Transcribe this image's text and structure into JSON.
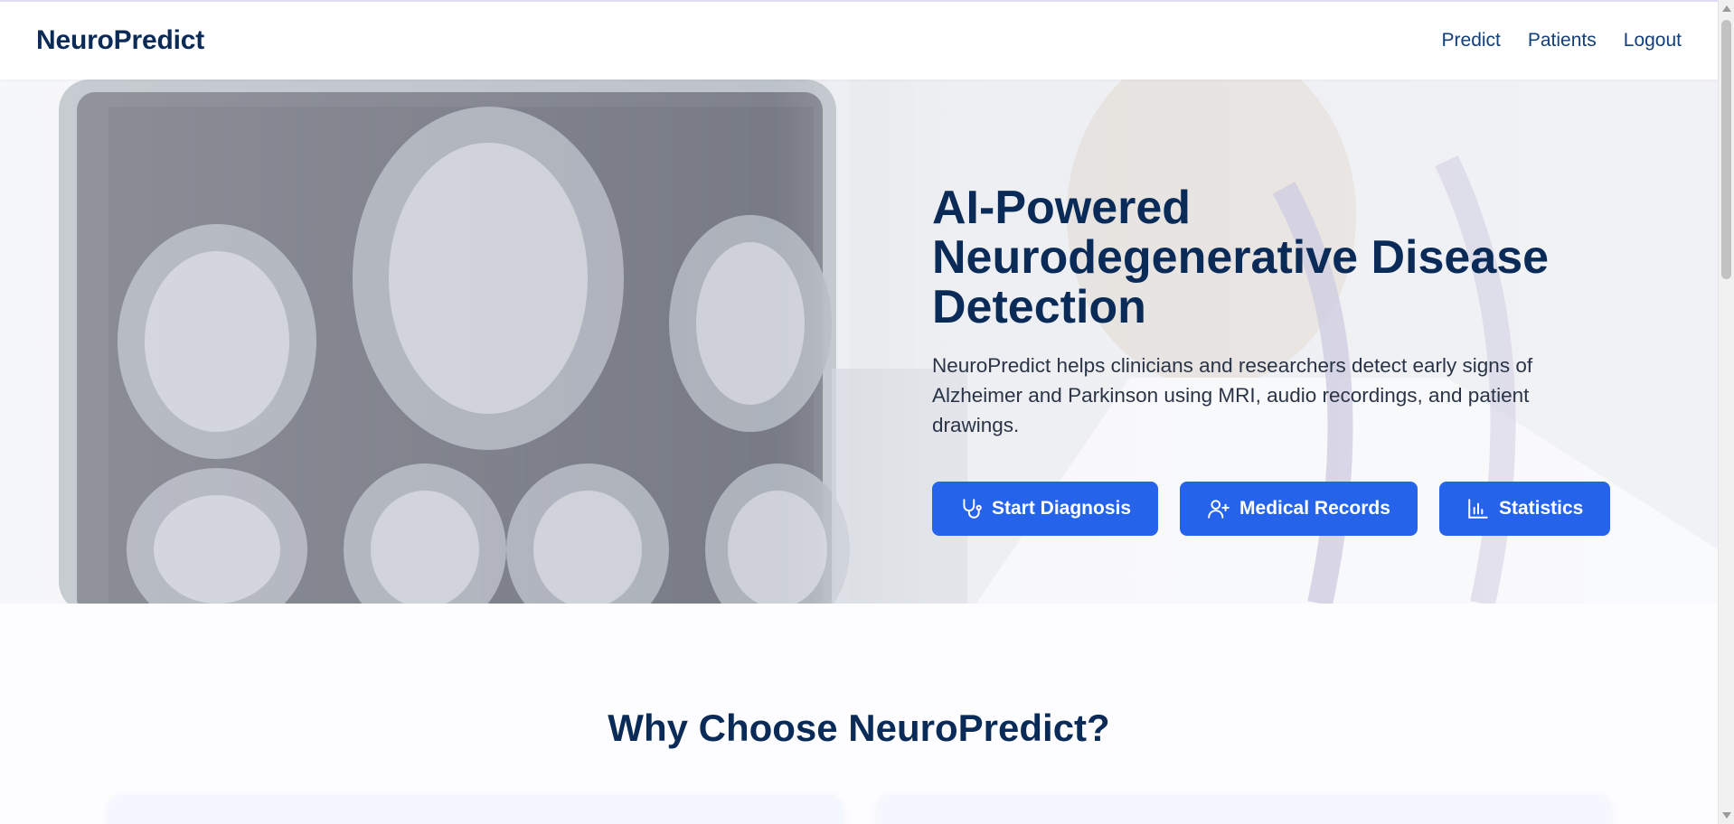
{
  "brand": "NeuroPredict",
  "nav": {
    "items": [
      "Predict",
      "Patients",
      "Logout"
    ]
  },
  "hero": {
    "title": "AI-Powered Neurodegenerative Disease Detection",
    "description": "NeuroPredict helps clinicians and researchers detect early signs of Alzheimer and Parkinson using MRI, audio recordings, and patient drawings.",
    "buttons": [
      {
        "label": "Start Diagnosis",
        "icon": "stethoscope-icon"
      },
      {
        "label": "Medical Records",
        "icon": "user-plus-icon"
      },
      {
        "label": "Statistics",
        "icon": "bar-chart-icon"
      }
    ]
  },
  "why": {
    "title": "Why Choose NeuroPredict?"
  },
  "colors": {
    "brand_navy": "#0a2b58",
    "button_blue": "#2563eb",
    "nav_link": "#123e7a"
  }
}
